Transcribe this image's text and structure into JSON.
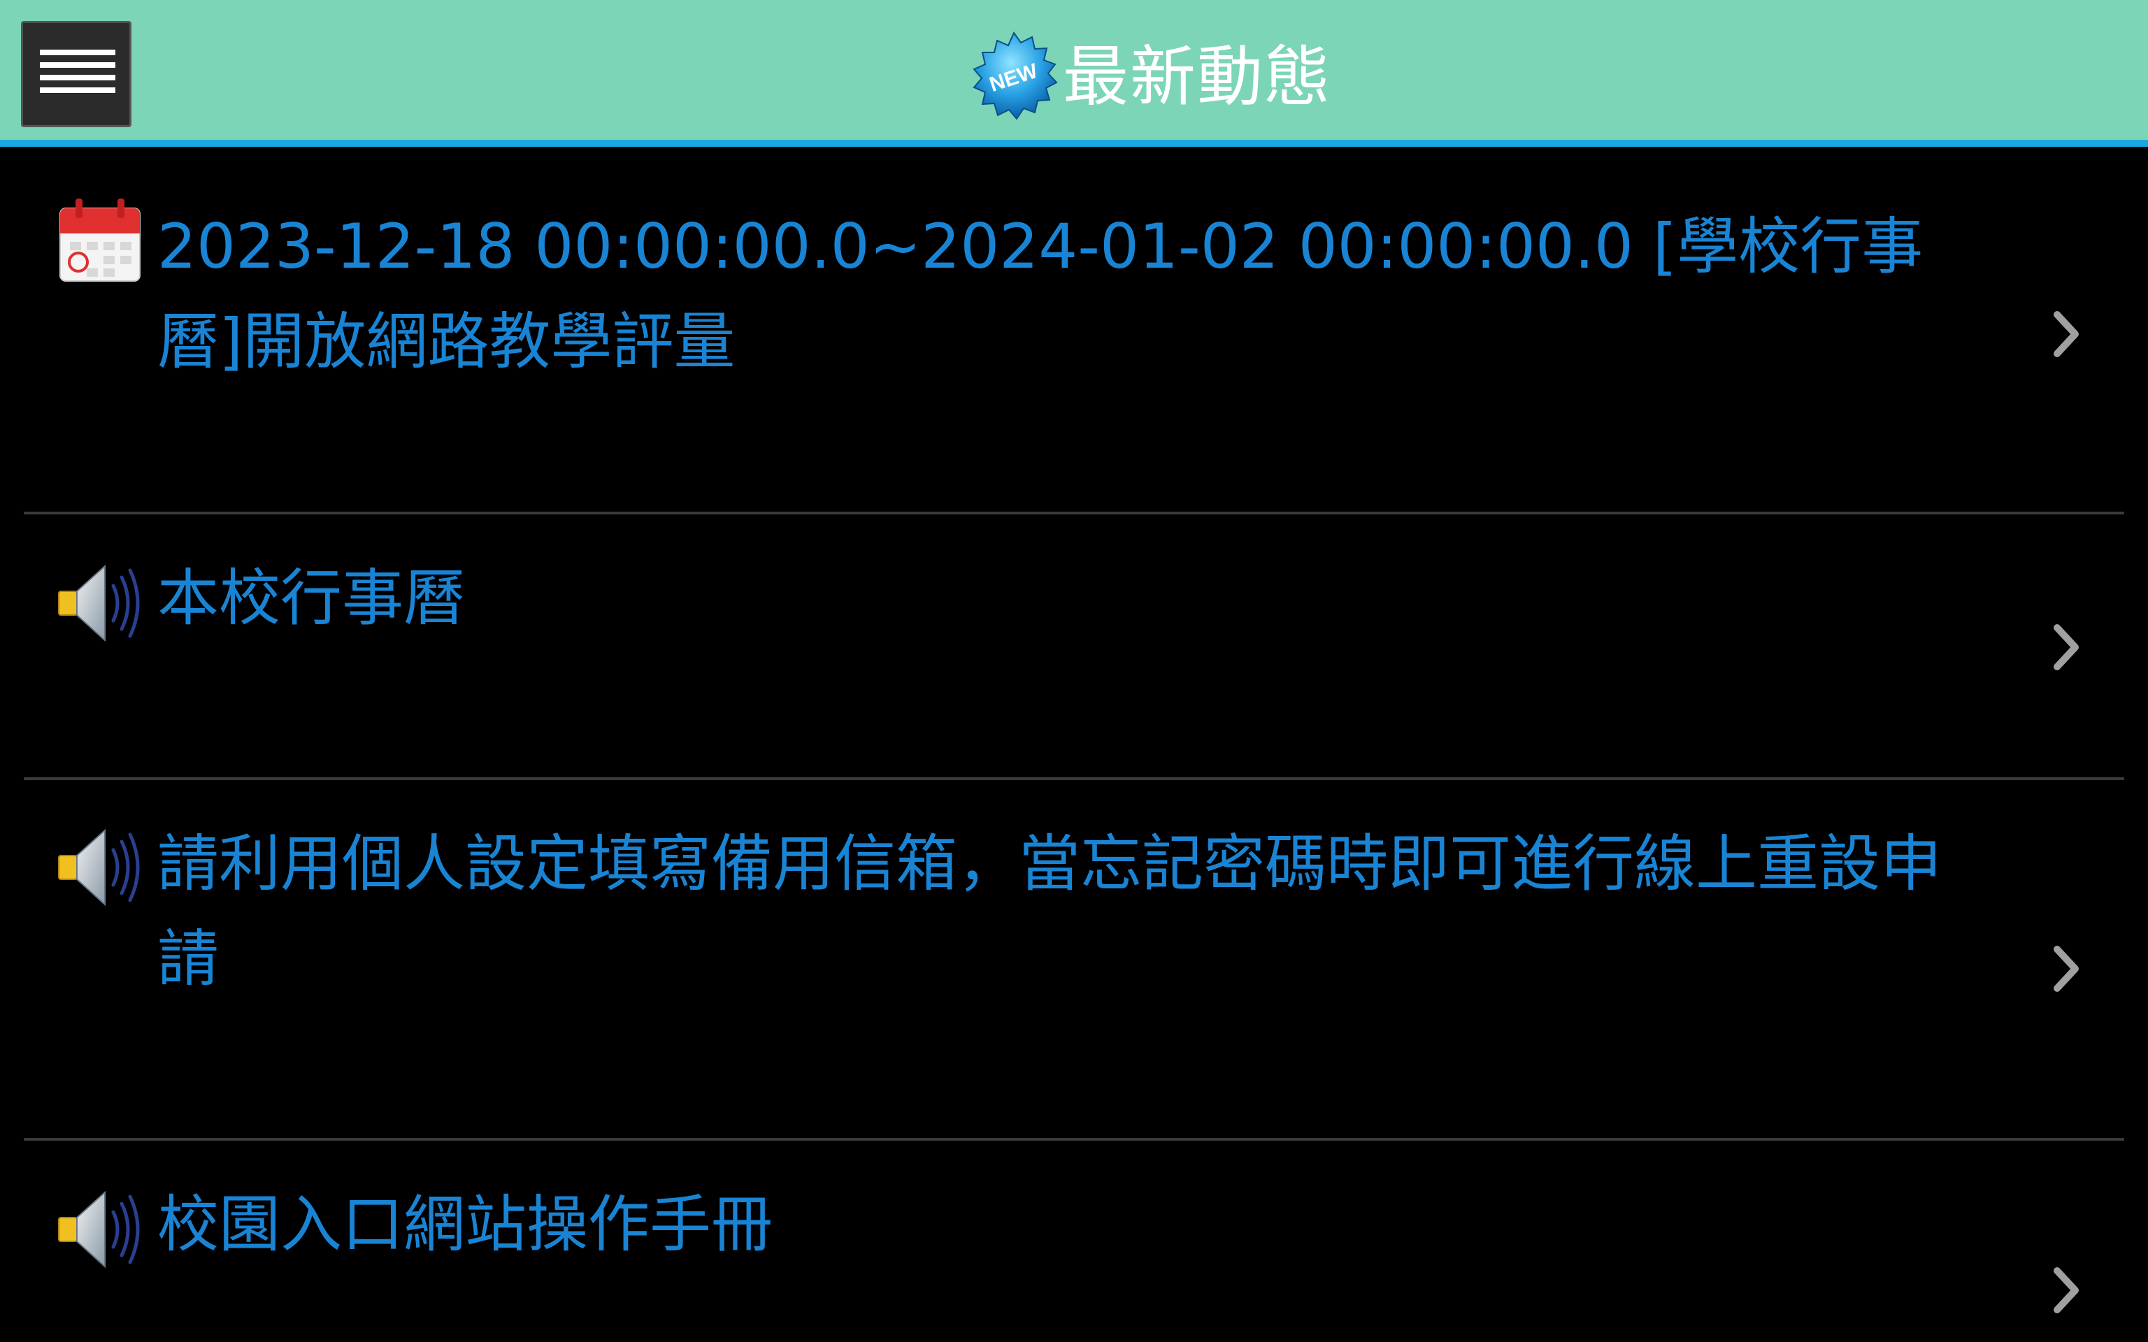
{
  "header": {
    "title": "最新動態",
    "menu_icon": "hamburger-menu-icon",
    "badge_icon": "new-badge-icon",
    "badge_text": "NEW",
    "bg_color": "#7dd5b8",
    "accent_color": "#1aa8e0"
  },
  "news": {
    "text_color": "#1a84d4",
    "items": [
      {
        "icon": "calendar-icon",
        "text": "2023-12-18 00:00:00.0~2024-01-02 00:00:00.0 [學校行事曆]開放網路教學評量"
      },
      {
        "icon": "speaker-icon",
        "text": "本校行事曆"
      },
      {
        "icon": "speaker-icon",
        "text": "請利用個人設定填寫備用信箱，當忘記密碼時即可進行線上重設申請"
      },
      {
        "icon": "speaker-icon",
        "text": "校園入口網站操作手冊"
      }
    ]
  }
}
